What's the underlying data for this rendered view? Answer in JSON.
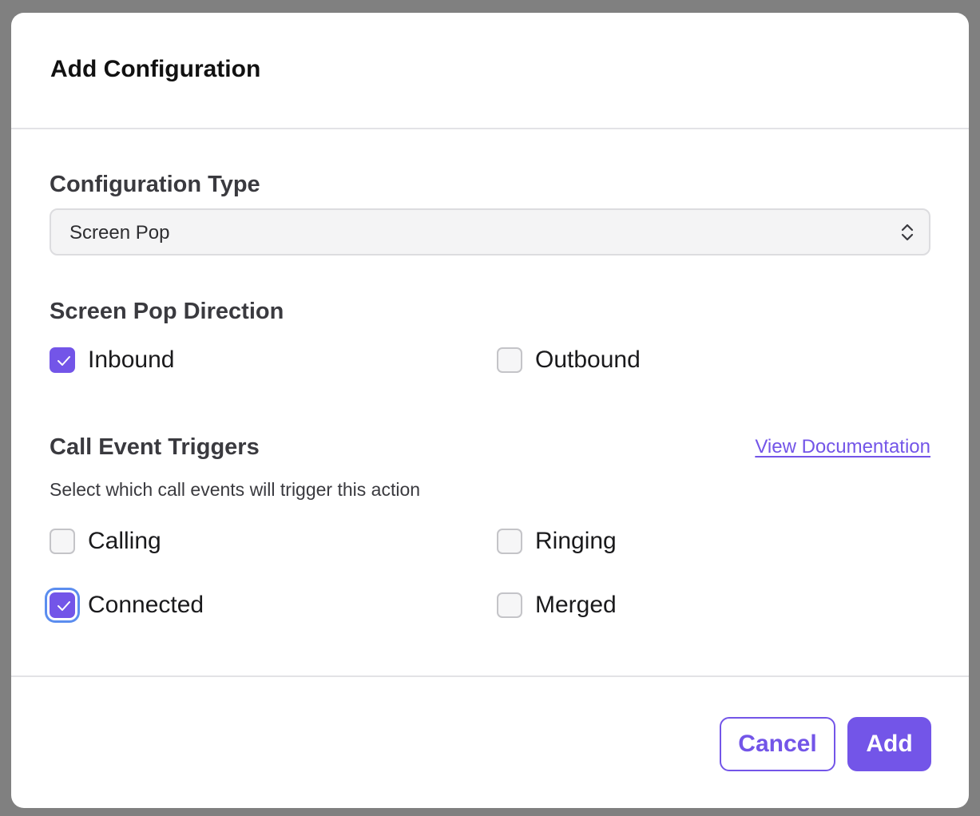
{
  "dialog": {
    "title": "Add Configuration"
  },
  "configuration_type": {
    "label": "Configuration Type",
    "selected_value": "Screen Pop",
    "icon": "chevron-up-down-icon"
  },
  "direction": {
    "label": "Screen Pop Direction",
    "options": [
      {
        "label": "Inbound",
        "checked": true
      },
      {
        "label": "Outbound",
        "checked": false
      }
    ]
  },
  "triggers": {
    "label": "Call Event Triggers",
    "doc_link": "View Documentation",
    "helper": "Select which call events will trigger this action",
    "options": [
      {
        "label": "Calling",
        "checked": false
      },
      {
        "label": "Ringing",
        "checked": false
      },
      {
        "label": "Connected",
        "checked": true,
        "focused": true
      },
      {
        "label": "Merged",
        "checked": false
      }
    ]
  },
  "footer": {
    "cancel_label": "Cancel",
    "add_label": "Add"
  },
  "colors": {
    "accent": "#7355e8",
    "focus_ring": "#5b8def",
    "backdrop": "#808080"
  }
}
